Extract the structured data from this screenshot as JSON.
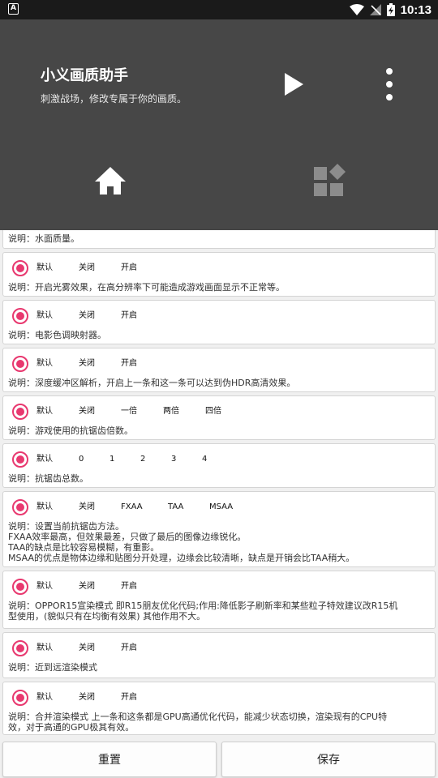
{
  "status_bar": {
    "time": "10:13",
    "notification_icon": "A"
  },
  "header": {
    "title": "小义画质助手",
    "subtitle": "刺激战场，修改专属于你的画质。"
  },
  "partial_desc": "说明：水面质量。",
  "cards": [
    {
      "options": [
        "默认",
        "关闭",
        "开启"
      ],
      "description": [
        "说明：开启光雾效果，在高分辨率下可能造成游戏画面显示不正常等。"
      ]
    },
    {
      "options": [
        "默认",
        "关闭",
        "开启"
      ],
      "description": [
        "说明：电影色调映射器。"
      ]
    },
    {
      "options": [
        "默认",
        "关闭",
        "开启"
      ],
      "description": [
        "说明：深度缓冲区解析，开启上一条和这一条可以达到伪HDR高清效果。"
      ]
    },
    {
      "options": [
        "默认",
        "关闭",
        "一倍",
        "两倍",
        "四倍"
      ],
      "description": [
        "说明：游戏使用的抗锯齿倍数。"
      ]
    },
    {
      "options": [
        "默认",
        "0",
        "1",
        "2",
        "3",
        "4"
      ],
      "description": [
        "说明：抗锯齿总数。"
      ]
    },
    {
      "options": [
        "默认",
        "关闭",
        "FXAA",
        "TAA",
        "MSAA"
      ],
      "description": [
        "说明：设置当前抗锯齿方法。",
        "FXAA效率最高，但效果最差，只做了最后的图像边缘锐化。",
        "TAA的缺点是比较容易模糊，有重影。",
        "MSAA的优点是物体边缘和贴图分开处理，边缘会比较清晰，缺点是开销会比TAA稍大。"
      ]
    },
    {
      "options": [
        "默认",
        "关闭",
        "开启"
      ],
      "description": [
        "说明：OPPOR15宣染模式  即R15朋友优化代码;作用:降低影子刷新率和某些粒子特效建议改R15机",
        "型使用，(貌似只有在均衡有效果) 其他作用不大。"
      ]
    },
    {
      "options": [
        "默认",
        "关闭",
        "开启"
      ],
      "description": [
        "说明：近到远渲染模式"
      ]
    },
    {
      "options": [
        "默认",
        "关闭",
        "开启"
      ],
      "description": [
        "说明：合并渲染模式  上一条和这条都是GPU高通优化代码，能减少状态切换，渲染现有的CPU特",
        "效，对于高通的GPU极其有效。"
      ]
    }
  ],
  "buttons": {
    "reset": "重置",
    "save": "保存"
  },
  "colors": {
    "header_bg": "#474747",
    "accent_radio": "#e8386f"
  }
}
